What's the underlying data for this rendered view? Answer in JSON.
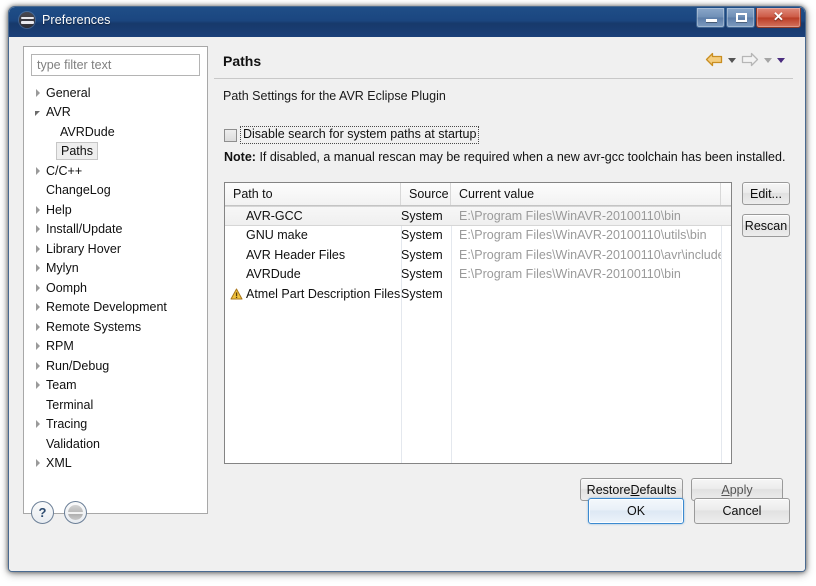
{
  "window": {
    "title": "Preferences",
    "icon": "eclipse-icon",
    "controls": {
      "minimize": "minimize-icon",
      "maximize": "maximize-icon",
      "close": "✕"
    }
  },
  "sidebar": {
    "filter": {
      "placeholder": "type filter text",
      "value": ""
    },
    "items": [
      {
        "label": "General",
        "expandable": true,
        "expanded": false,
        "indent": 0,
        "selected": false
      },
      {
        "label": "AVR",
        "expandable": true,
        "expanded": true,
        "indent": 0,
        "selected": false
      },
      {
        "label": "AVRDude",
        "expandable": false,
        "expanded": false,
        "indent": 1,
        "selected": false
      },
      {
        "label": "Paths",
        "expandable": false,
        "expanded": false,
        "indent": 1,
        "selected": true
      },
      {
        "label": "C/C++",
        "expandable": true,
        "expanded": false,
        "indent": 0,
        "selected": false
      },
      {
        "label": "ChangeLog",
        "expandable": false,
        "expanded": false,
        "indent": 0,
        "selected": false
      },
      {
        "label": "Help",
        "expandable": true,
        "expanded": false,
        "indent": 0,
        "selected": false
      },
      {
        "label": "Install/Update",
        "expandable": true,
        "expanded": false,
        "indent": 0,
        "selected": false
      },
      {
        "label": "Library Hover",
        "expandable": true,
        "expanded": false,
        "indent": 0,
        "selected": false
      },
      {
        "label": "Mylyn",
        "expandable": true,
        "expanded": false,
        "indent": 0,
        "selected": false
      },
      {
        "label": "Oomph",
        "expandable": true,
        "expanded": false,
        "indent": 0,
        "selected": false
      },
      {
        "label": "Remote Development",
        "expandable": true,
        "expanded": false,
        "indent": 0,
        "selected": false
      },
      {
        "label": "Remote Systems",
        "expandable": true,
        "expanded": false,
        "indent": 0,
        "selected": false
      },
      {
        "label": "RPM",
        "expandable": true,
        "expanded": false,
        "indent": 0,
        "selected": false
      },
      {
        "label": "Run/Debug",
        "expandable": true,
        "expanded": false,
        "indent": 0,
        "selected": false
      },
      {
        "label": "Team",
        "expandable": true,
        "expanded": false,
        "indent": 0,
        "selected": false
      },
      {
        "label": "Terminal",
        "expandable": false,
        "expanded": false,
        "indent": 0,
        "selected": false
      },
      {
        "label": "Tracing",
        "expandable": true,
        "expanded": false,
        "indent": 0,
        "selected": false
      },
      {
        "label": "Validation",
        "expandable": false,
        "expanded": false,
        "indent": 0,
        "selected": false
      },
      {
        "label": "XML",
        "expandable": true,
        "expanded": false,
        "indent": 0,
        "selected": false
      }
    ]
  },
  "page": {
    "title": "Paths",
    "description": "Path Settings for the AVR Eclipse Plugin",
    "nav": {
      "back_icon": "back-arrow-icon",
      "back_enabled": true,
      "forward_icon": "forward-arrow-icon",
      "forward_enabled": false,
      "back_color": "#e8a33d",
      "forward_color": "#bfbfbf"
    },
    "checkbox": {
      "label": "Disable search for system paths at startup",
      "checked": false,
      "focused": true
    },
    "note": {
      "prefix": "Note:",
      "text": "If disabled, a manual rescan may be required when a new avr-gcc toolchain has been installed."
    }
  },
  "table": {
    "columns": [
      "Path to",
      "Source",
      "Current value"
    ],
    "rows": [
      {
        "name": "AVR-GCC",
        "source": "System",
        "value": "E:\\Program Files\\WinAVR-20100110\\bin",
        "warning": false,
        "selected": true
      },
      {
        "name": "GNU make",
        "source": "System",
        "value": "E:\\Program Files\\WinAVR-20100110\\utils\\bin",
        "warning": false,
        "selected": false
      },
      {
        "name": "AVR Header Files",
        "source": "System",
        "value": "E:\\Program Files\\WinAVR-20100110\\avr\\include",
        "warning": false,
        "selected": false
      },
      {
        "name": "AVRDude",
        "source": "System",
        "value": "E:\\Program Files\\WinAVR-20100110\\bin",
        "warning": false,
        "selected": false
      },
      {
        "name": "Atmel Part Description Files",
        "source": "System",
        "value": "",
        "warning": true,
        "selected": false
      }
    ],
    "warning_icon": "warning-triangle-icon"
  },
  "buttons": {
    "edit": "Edit...",
    "rescan": "Rescan",
    "restore_defaults_pre": "Restore ",
    "restore_defaults_key": "D",
    "restore_defaults_post": "efaults",
    "apply_key": "A",
    "apply_post": "pply",
    "ok": "OK",
    "cancel": "Cancel",
    "help": "?",
    "help_icon": "question-mark-icon",
    "disc_icon": "eclipse-disc-icon"
  }
}
